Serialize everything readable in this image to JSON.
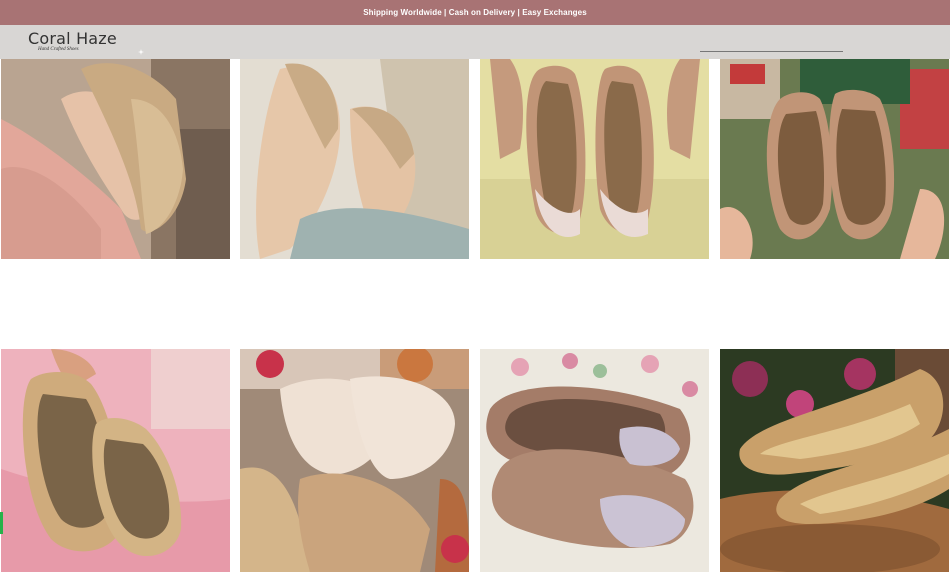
{
  "announcement": {
    "text": "Shipping Worldwide | Cash on Delivery | Easy Exchanges"
  },
  "brand": {
    "name": "Coral Haze",
    "tagline": "Hand Crafted Shoes"
  },
  "header": {
    "icon": "sparkle-icon",
    "search_placeholder": ""
  },
  "colors": {
    "announcement_bg": "#a87374",
    "header_bg": "#d8d6d4"
  },
  "products": [
    {
      "name": "product-image-1"
    },
    {
      "name": "product-image-2"
    },
    {
      "name": "product-image-3"
    },
    {
      "name": "product-image-4"
    },
    {
      "name": "product-image-5"
    },
    {
      "name": "product-image-6"
    },
    {
      "name": "product-image-7"
    },
    {
      "name": "product-image-8"
    }
  ]
}
